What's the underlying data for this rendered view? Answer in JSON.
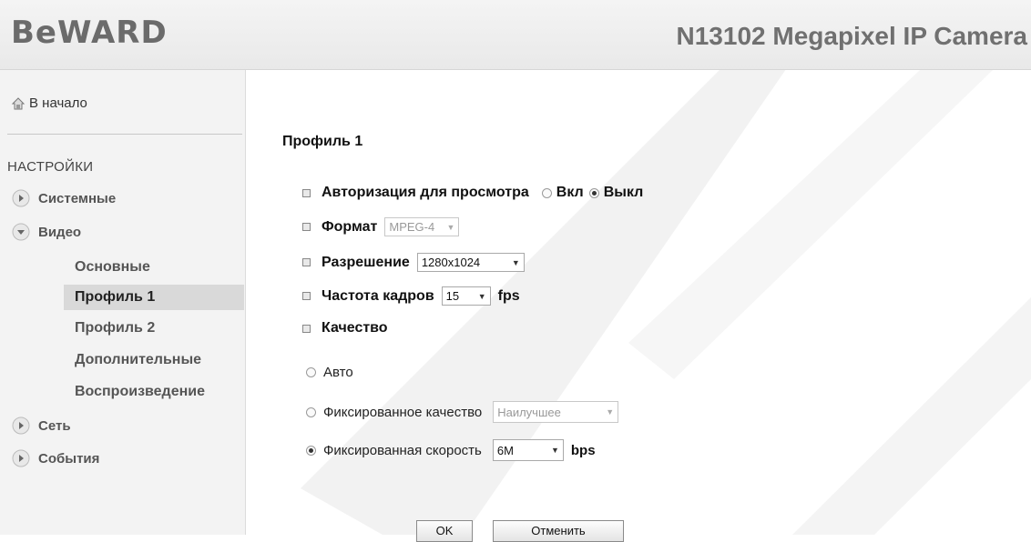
{
  "header": {
    "logo": "BeWARD",
    "model": "N13102 Megapixel IP Camera"
  },
  "sidebar": {
    "home": "В начало",
    "section": "НАСТРОЙКИ",
    "items": [
      {
        "label": "Системные"
      },
      {
        "label": "Видео"
      },
      {
        "label": "Сеть"
      },
      {
        "label": "События"
      }
    ],
    "video_sub": [
      {
        "label": "Основные"
      },
      {
        "label": "Профиль 1"
      },
      {
        "label": "Профиль 2"
      },
      {
        "label": "Дополнительные"
      },
      {
        "label": "Воспроизведение"
      }
    ]
  },
  "main": {
    "title": "Профиль 1",
    "auth": {
      "label": "Авторизация для просмотра",
      "on": "Вкл",
      "off": "Выкл"
    },
    "format": {
      "label": "Формат",
      "value": "MPEG-4"
    },
    "resolution": {
      "label": "Разрешение",
      "value": "1280x1024"
    },
    "fps": {
      "label": "Частота кадров",
      "value": "15",
      "unit": "fps"
    },
    "quality": {
      "label": "Качество",
      "auto": "Авто",
      "fixed_quality": "Фиксированное качество",
      "fixed_quality_value": "Наилучшее",
      "fixed_rate": "Фиксированная скорость",
      "fixed_rate_value": "6M",
      "rate_unit": "bps"
    },
    "ok": "OK",
    "cancel": "Отменить"
  }
}
